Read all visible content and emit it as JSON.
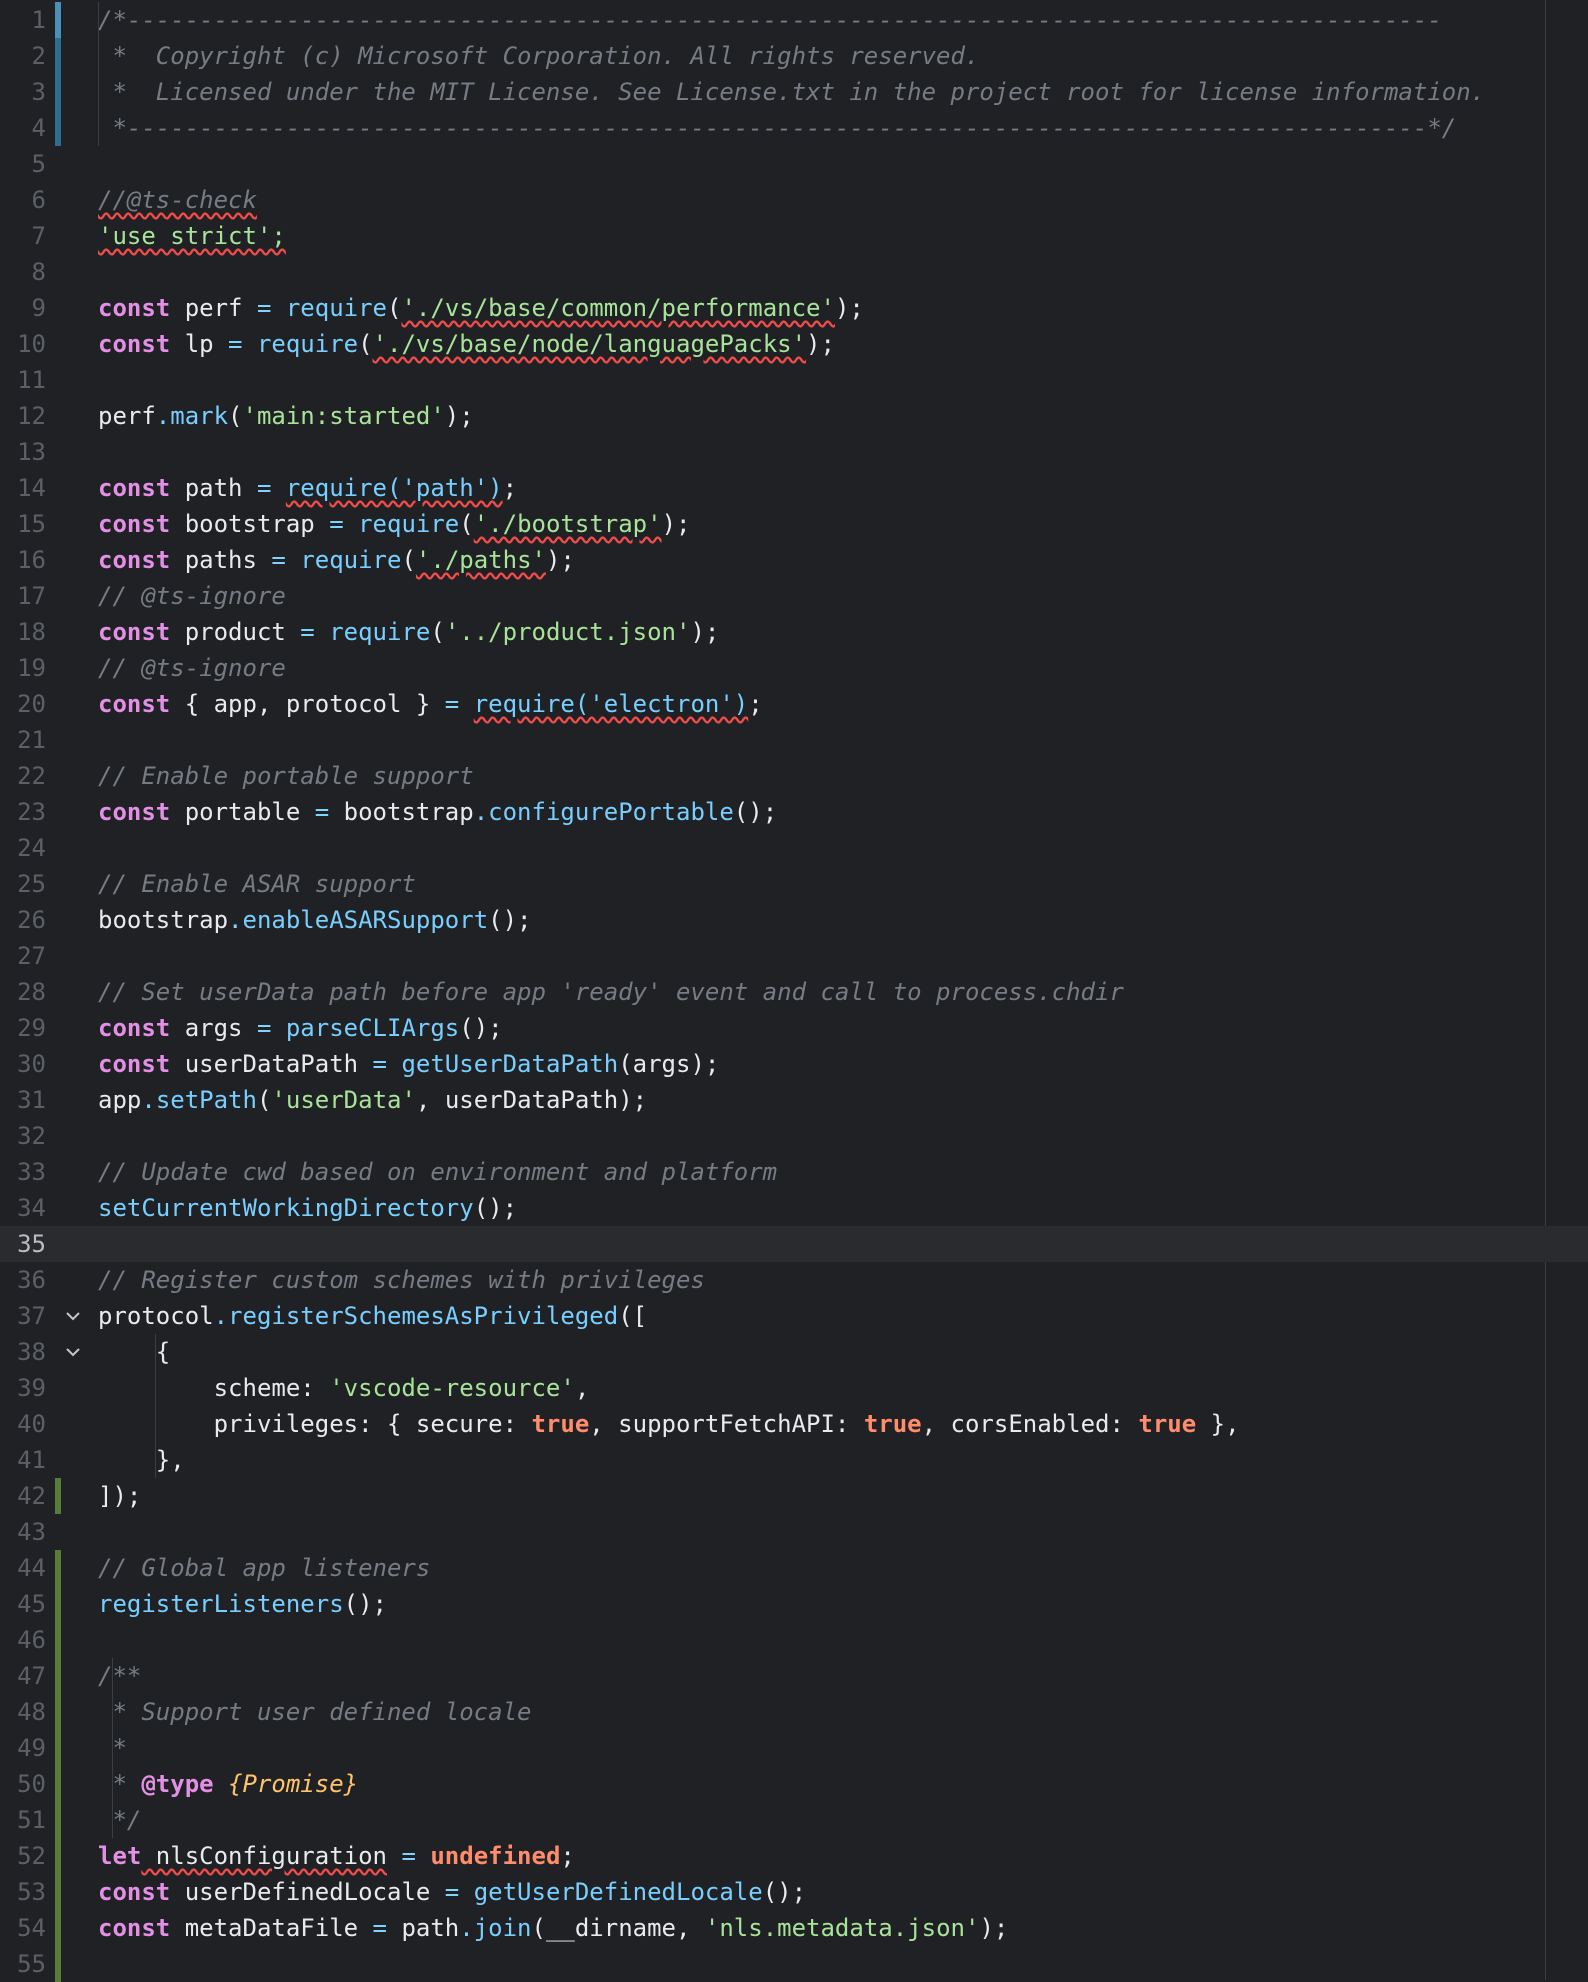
{
  "editor": {
    "current_line": 35,
    "lines": [
      {
        "n": "1",
        "tokens": [
          {
            "t": "/*-------------------------------------------------------------------------------------------",
            "c": "cm"
          }
        ]
      },
      {
        "n": "2",
        "tokens": [
          {
            "t": " *  Copyright (c) Microsoft Corporation. All rights reserved.",
            "c": "cm"
          }
        ]
      },
      {
        "n": "3",
        "tokens": [
          {
            "t": " *  Licensed under the MIT License. See License.txt in the project root for license information.",
            "c": "cm"
          }
        ]
      },
      {
        "n": "4",
        "tokens": [
          {
            "t": " *------------------------------------------------------------------------------------------*/",
            "c": "cm"
          }
        ]
      },
      {
        "n": "5",
        "tokens": []
      },
      {
        "n": "6",
        "tokens": [
          {
            "t": "//@ts-check",
            "c": "cm",
            "s": true
          }
        ]
      },
      {
        "n": "7",
        "tokens": [
          {
            "t": "'use strict';",
            "c": "str",
            "s": true
          }
        ]
      },
      {
        "n": "8",
        "tokens": []
      },
      {
        "n": "9",
        "tokens": [
          {
            "t": "const",
            "c": "kw"
          },
          {
            "t": " perf ",
            "c": "pl"
          },
          {
            "t": "=",
            "c": "op"
          },
          {
            "t": " ",
            "c": "pl"
          },
          {
            "t": "require",
            "c": "fn"
          },
          {
            "t": "(",
            "c": "pl"
          },
          {
            "t": "'./vs/base/common/performance'",
            "c": "str",
            "s": true
          },
          {
            "t": ");",
            "c": "pl"
          }
        ]
      },
      {
        "n": "10",
        "tokens": [
          {
            "t": "const",
            "c": "kw"
          },
          {
            "t": " lp ",
            "c": "pl"
          },
          {
            "t": "=",
            "c": "op"
          },
          {
            "t": " ",
            "c": "pl"
          },
          {
            "t": "require",
            "c": "fn"
          },
          {
            "t": "(",
            "c": "pl"
          },
          {
            "t": "'./vs/base/node/languagePacks'",
            "c": "str",
            "s": true
          },
          {
            "t": ");",
            "c": "pl"
          }
        ]
      },
      {
        "n": "11",
        "tokens": []
      },
      {
        "n": "12",
        "tokens": [
          {
            "t": "perf",
            "c": "pl"
          },
          {
            "t": ".",
            "c": "op"
          },
          {
            "t": "mark",
            "c": "fn"
          },
          {
            "t": "(",
            "c": "pl"
          },
          {
            "t": "'main:started'",
            "c": "str"
          },
          {
            "t": ");",
            "c": "pl"
          }
        ]
      },
      {
        "n": "13",
        "tokens": []
      },
      {
        "n": "14",
        "tokens": [
          {
            "t": "const",
            "c": "kw"
          },
          {
            "t": " path ",
            "c": "pl"
          },
          {
            "t": "=",
            "c": "op"
          },
          {
            "t": " ",
            "c": "pl"
          },
          {
            "t": "require('path')",
            "c": "fn",
            "s": true
          },
          {
            "t": ";",
            "c": "pl"
          }
        ]
      },
      {
        "n": "15",
        "tokens": [
          {
            "t": "const",
            "c": "kw"
          },
          {
            "t": " bootstrap ",
            "c": "pl"
          },
          {
            "t": "=",
            "c": "op"
          },
          {
            "t": " ",
            "c": "pl"
          },
          {
            "t": "require",
            "c": "fn"
          },
          {
            "t": "(",
            "c": "pl"
          },
          {
            "t": "'./bootstrap'",
            "c": "str",
            "s": true
          },
          {
            "t": ");",
            "c": "pl"
          }
        ]
      },
      {
        "n": "16",
        "tokens": [
          {
            "t": "const",
            "c": "kw"
          },
          {
            "t": " paths ",
            "c": "pl"
          },
          {
            "t": "=",
            "c": "op"
          },
          {
            "t": " ",
            "c": "pl"
          },
          {
            "t": "require",
            "c": "fn"
          },
          {
            "t": "(",
            "c": "pl"
          },
          {
            "t": "'./paths'",
            "c": "str",
            "s": true
          },
          {
            "t": ");",
            "c": "pl"
          }
        ]
      },
      {
        "n": "17",
        "tokens": [
          {
            "t": "// @ts-ignore",
            "c": "cm"
          }
        ]
      },
      {
        "n": "18",
        "tokens": [
          {
            "t": "const",
            "c": "kw"
          },
          {
            "t": " product ",
            "c": "pl"
          },
          {
            "t": "=",
            "c": "op"
          },
          {
            "t": " ",
            "c": "pl"
          },
          {
            "t": "require",
            "c": "fn"
          },
          {
            "t": "(",
            "c": "pl"
          },
          {
            "t": "'../product.json'",
            "c": "str"
          },
          {
            "t": ");",
            "c": "pl"
          }
        ]
      },
      {
        "n": "19",
        "tokens": [
          {
            "t": "// @ts-ignore",
            "c": "cm"
          }
        ]
      },
      {
        "n": "20",
        "tokens": [
          {
            "t": "const",
            "c": "kw"
          },
          {
            "t": " { app, protocol } ",
            "c": "pl"
          },
          {
            "t": "=",
            "c": "op"
          },
          {
            "t": " ",
            "c": "pl"
          },
          {
            "t": "require('electron')",
            "c": "fn",
            "s": true
          },
          {
            "t": ";",
            "c": "pl"
          }
        ]
      },
      {
        "n": "21",
        "tokens": []
      },
      {
        "n": "22",
        "tokens": [
          {
            "t": "// Enable portable support",
            "c": "cm"
          }
        ]
      },
      {
        "n": "23",
        "tokens": [
          {
            "t": "const",
            "c": "kw"
          },
          {
            "t": " portable ",
            "c": "pl"
          },
          {
            "t": "=",
            "c": "op"
          },
          {
            "t": " bootstrap",
            "c": "pl"
          },
          {
            "t": ".",
            "c": "op"
          },
          {
            "t": "configurePortable",
            "c": "fn"
          },
          {
            "t": "();",
            "c": "pl"
          }
        ]
      },
      {
        "n": "24",
        "tokens": []
      },
      {
        "n": "25",
        "tokens": [
          {
            "t": "// Enable ASAR support",
            "c": "cm"
          }
        ]
      },
      {
        "n": "26",
        "tokens": [
          {
            "t": "bootstrap",
            "c": "pl"
          },
          {
            "t": ".",
            "c": "op"
          },
          {
            "t": "enableASARSupport",
            "c": "fn"
          },
          {
            "t": "();",
            "c": "pl"
          }
        ]
      },
      {
        "n": "27",
        "tokens": []
      },
      {
        "n": "28",
        "tokens": [
          {
            "t": "// Set userData path before app 'ready' event and call to process.chdir",
            "c": "cm"
          }
        ]
      },
      {
        "n": "29",
        "tokens": [
          {
            "t": "const",
            "c": "kw"
          },
          {
            "t": " args ",
            "c": "pl"
          },
          {
            "t": "=",
            "c": "op"
          },
          {
            "t": " ",
            "c": "pl"
          },
          {
            "t": "parseCLIArgs",
            "c": "fn"
          },
          {
            "t": "();",
            "c": "pl"
          }
        ]
      },
      {
        "n": "30",
        "tokens": [
          {
            "t": "const",
            "c": "kw"
          },
          {
            "t": " userDataPath ",
            "c": "pl"
          },
          {
            "t": "=",
            "c": "op"
          },
          {
            "t": " ",
            "c": "pl"
          },
          {
            "t": "getUserDataPath",
            "c": "fn"
          },
          {
            "t": "(args);",
            "c": "pl"
          }
        ]
      },
      {
        "n": "31",
        "tokens": [
          {
            "t": "app",
            "c": "pl"
          },
          {
            "t": ".",
            "c": "op"
          },
          {
            "t": "setPath",
            "c": "fn"
          },
          {
            "t": "(",
            "c": "pl"
          },
          {
            "t": "'userData'",
            "c": "str"
          },
          {
            "t": ", userDataPath);",
            "c": "pl"
          }
        ]
      },
      {
        "n": "32",
        "tokens": []
      },
      {
        "n": "33",
        "tokens": [
          {
            "t": "// Update cwd based on environment and platform",
            "c": "cm"
          }
        ]
      },
      {
        "n": "34",
        "tokens": [
          {
            "t": "setCurrentWorkingDirectory",
            "c": "fn"
          },
          {
            "t": "();",
            "c": "pl"
          }
        ]
      },
      {
        "n": "35",
        "tokens": []
      },
      {
        "n": "36",
        "tokens": [
          {
            "t": "// Register custom schemes with privileges",
            "c": "cm"
          }
        ]
      },
      {
        "n": "37",
        "fold": true,
        "tokens": [
          {
            "t": "protocol",
            "c": "pl"
          },
          {
            "t": ".",
            "c": "op"
          },
          {
            "t": "registerSchemesAsPrivileged",
            "c": "fn"
          },
          {
            "t": "([",
            "c": "pl"
          }
        ]
      },
      {
        "n": "38",
        "fold": true,
        "tokens": [
          {
            "t": "    {",
            "c": "pl"
          }
        ]
      },
      {
        "n": "39",
        "tokens": [
          {
            "t": "        scheme: ",
            "c": "pl"
          },
          {
            "t": "'vscode-resource'",
            "c": "str"
          },
          {
            "t": ",",
            "c": "pl"
          }
        ]
      },
      {
        "n": "40",
        "tokens": [
          {
            "t": "        privileges: { secure: ",
            "c": "pl"
          },
          {
            "t": "true",
            "c": "num"
          },
          {
            "t": ", supportFetchAPI: ",
            "c": "pl"
          },
          {
            "t": "true",
            "c": "num"
          },
          {
            "t": ", corsEnabled: ",
            "c": "pl"
          },
          {
            "t": "true",
            "c": "num"
          },
          {
            "t": " },",
            "c": "pl"
          }
        ]
      },
      {
        "n": "41",
        "tokens": [
          {
            "t": "    },",
            "c": "pl"
          }
        ]
      },
      {
        "n": "42",
        "tokens": [
          {
            "t": "]);",
            "c": "pl"
          }
        ]
      },
      {
        "n": "43",
        "tokens": []
      },
      {
        "n": "44",
        "tokens": [
          {
            "t": "// Global app listeners",
            "c": "cm"
          }
        ]
      },
      {
        "n": "45",
        "tokens": [
          {
            "t": "registerListeners",
            "c": "fn"
          },
          {
            "t": "();",
            "c": "pl"
          }
        ]
      },
      {
        "n": "46",
        "tokens": []
      },
      {
        "n": "47",
        "tokens": [
          {
            "t": "/**",
            "c": "cm"
          }
        ]
      },
      {
        "n": "48",
        "tokens": [
          {
            "t": " * Support user defined locale",
            "c": "cm"
          }
        ]
      },
      {
        "n": "49",
        "tokens": [
          {
            "t": " *",
            "c": "cm"
          }
        ]
      },
      {
        "n": "50",
        "tokens": [
          {
            "t": " * ",
            "c": "cm"
          },
          {
            "t": "@type",
            "c": "kw"
          },
          {
            "t": " ",
            "c": "cm"
          },
          {
            "t": "{Promise}",
            "c": "type"
          }
        ]
      },
      {
        "n": "51",
        "tokens": [
          {
            "t": " */",
            "c": "cm"
          }
        ]
      },
      {
        "n": "52",
        "tokens": [
          {
            "t": "let",
            "c": "kw"
          },
          {
            "t": " nlsConfiguration",
            "c": "pl",
            "s": true
          },
          {
            "t": " ",
            "c": "pl"
          },
          {
            "t": "=",
            "c": "op"
          },
          {
            "t": " ",
            "c": "pl"
          },
          {
            "t": "undefined",
            "c": "num"
          },
          {
            "t": ";",
            "c": "pl"
          }
        ]
      },
      {
        "n": "53",
        "tokens": [
          {
            "t": "const",
            "c": "kw"
          },
          {
            "t": " userDefinedLocale ",
            "c": "pl"
          },
          {
            "t": "=",
            "c": "op"
          },
          {
            "t": " ",
            "c": "pl"
          },
          {
            "t": "getUserDefinedLocale",
            "c": "fn"
          },
          {
            "t": "();",
            "c": "pl"
          }
        ]
      },
      {
        "n": "54",
        "tokens": [
          {
            "t": "const",
            "c": "kw"
          },
          {
            "t": " metaDataFile ",
            "c": "pl"
          },
          {
            "t": "=",
            "c": "op"
          },
          {
            "t": " path",
            "c": "pl"
          },
          {
            "t": ".",
            "c": "op"
          },
          {
            "t": "join",
            "c": "fn"
          },
          {
            "t": "(__dirname, ",
            "c": "pl"
          },
          {
            "t": "'nls.metadata.json'",
            "c": "str"
          },
          {
            "t": ");",
            "c": "pl"
          }
        ]
      },
      {
        "n": "55",
        "tokens": []
      }
    ]
  },
  "gutter_markers": [
    {
      "from": 1,
      "to": 4,
      "color": "#2f6d8f"
    },
    {
      "from": 1,
      "to": 1,
      "color": "#4a90b8"
    },
    {
      "from": 42,
      "to": 42,
      "color": "#587c3a"
    },
    {
      "from": 44,
      "to": 55,
      "color": "#587c3a"
    }
  ]
}
